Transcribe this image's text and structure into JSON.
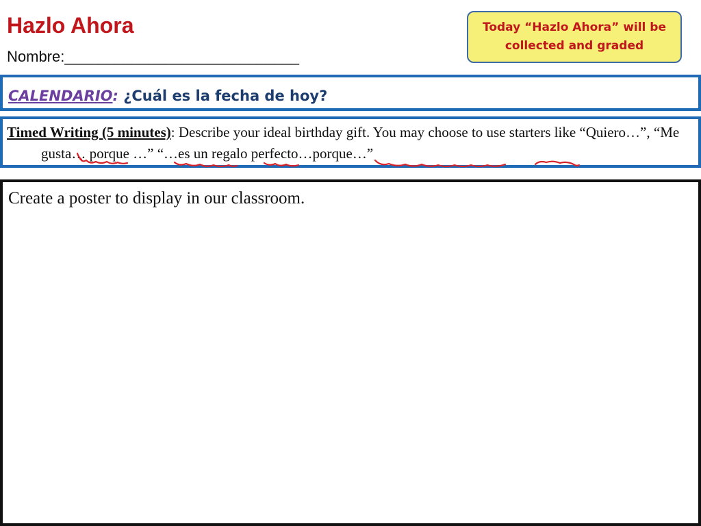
{
  "header": {
    "title": "Hazlo Ahora",
    "name_label": "Nombre:____________________________"
  },
  "note": {
    "text": "Today “Hazlo Ahora”  will be collected and graded",
    "background_color": "#f6ef78",
    "text_color": "#c0161c",
    "border_color": "#3f6aa8"
  },
  "calendar": {
    "label": "CALENDARIO",
    "colon": ":",
    "question": " ¿Cuál es la fecha de hoy?"
  },
  "timed_writing": {
    "label": "Timed Writing  (5 minutes)",
    "colon": ":",
    "prompt": " Describe your ideal birthday gift. You may choose to use starters like “Quiero…”, “Me gusta… porque …” “…es un regalo perfecto…porque…”"
  },
  "poster": {
    "instruction": "Create a poster to display in our classroom."
  },
  "colors": {
    "title_red": "#c0161c",
    "band_blue": "#1f6ab4",
    "annotation_red": "#d8232a"
  }
}
